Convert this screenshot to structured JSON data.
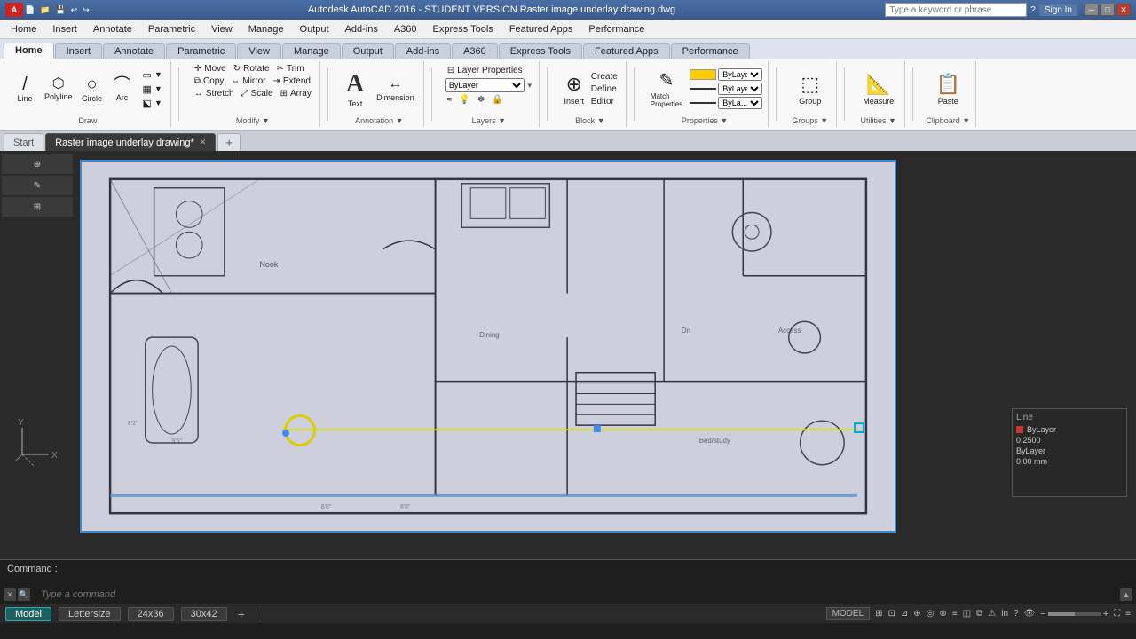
{
  "titlebar": {
    "title": "Autodesk AutoCAD 2016 - STUDENT VERSION  Raster image underlay drawing.dwg",
    "search_placeholder": "Type a keyword or phrase",
    "signin_label": "Sign In",
    "win_min": "─",
    "win_max": "□",
    "win_close": "✕"
  },
  "menubar": {
    "items": [
      "Home",
      "Insert",
      "Annotate",
      "Parametric",
      "View",
      "Manage",
      "Output",
      "Add-ins",
      "A360",
      "Express Tools",
      "Featured Apps",
      "Performance"
    ]
  },
  "ribbon": {
    "tabs": [
      {
        "label": "Home",
        "active": true
      },
      {
        "label": "Insert"
      },
      {
        "label": "Annotate"
      },
      {
        "label": "Parametric"
      },
      {
        "label": "View"
      },
      {
        "label": "Manage"
      },
      {
        "label": "Output"
      },
      {
        "label": "Add-ins"
      },
      {
        "label": "A360"
      },
      {
        "label": "Express Tools"
      },
      {
        "label": "Featured Apps"
      },
      {
        "label": "Performance"
      }
    ],
    "groups": {
      "draw": {
        "label": "Draw",
        "items": [
          {
            "id": "line",
            "label": "Line",
            "icon": "/"
          },
          {
            "id": "polyline",
            "label": "Polyline",
            "icon": "⬡"
          },
          {
            "id": "circle",
            "label": "Circle",
            "icon": "○"
          },
          {
            "id": "arc",
            "label": "Arc",
            "icon": "⌒"
          }
        ]
      },
      "modify": {
        "label": "Modify",
        "items": [
          {
            "id": "move",
            "label": "Move"
          },
          {
            "id": "copy",
            "label": "Copy"
          },
          {
            "id": "stretch",
            "label": "Stretch"
          }
        ]
      },
      "annotation": {
        "label": "Annotation",
        "items": [
          {
            "id": "text",
            "label": "Text"
          },
          {
            "id": "dimension",
            "label": "Dimension"
          }
        ]
      },
      "layers": {
        "label": "Layers",
        "layer_name": "ByLayer"
      },
      "block": {
        "label": "Block",
        "items": [
          {
            "id": "insert",
            "label": "Insert"
          }
        ]
      },
      "properties": {
        "label": "Properties",
        "items": [
          {
            "id": "match",
            "label": "Match Properties"
          }
        ]
      },
      "groups_group": {
        "label": "Groups",
        "items": [
          {
            "id": "group",
            "label": "Group"
          }
        ]
      },
      "utilities": {
        "label": "Utilities",
        "items": [
          {
            "id": "measure",
            "label": "Measure"
          }
        ]
      },
      "clipboard": {
        "label": "Clipboard",
        "items": [
          {
            "id": "paste",
            "label": "Paste"
          }
        ]
      }
    }
  },
  "breadcrumb": {
    "start": "Start"
  },
  "tabs": {
    "items": [
      {
        "label": "Raster image underlay drawing*",
        "active": true
      },
      {
        "label": "+",
        "is_new": true
      }
    ]
  },
  "right_panel": {
    "title": "Line",
    "rows": [
      {
        "color": "#cc3333",
        "text": "ByLayer"
      },
      {
        "text": "0.2500"
      },
      {
        "text": "ByLayer"
      },
      {
        "text": "0.00 mm"
      }
    ]
  },
  "command": {
    "label": "Command :",
    "placeholder": "Type a command"
  },
  "statusbar": {
    "tabs": [
      "Model",
      "Lettersize",
      "24x36",
      "30x42"
    ],
    "active_tab": "Model",
    "right_items": [
      "MODEL",
      "⬛⬛",
      "▼",
      "≡",
      "▼"
    ],
    "model_label": "MODEL"
  },
  "axis": {
    "y_label": "Y",
    "x_label": "X"
  }
}
